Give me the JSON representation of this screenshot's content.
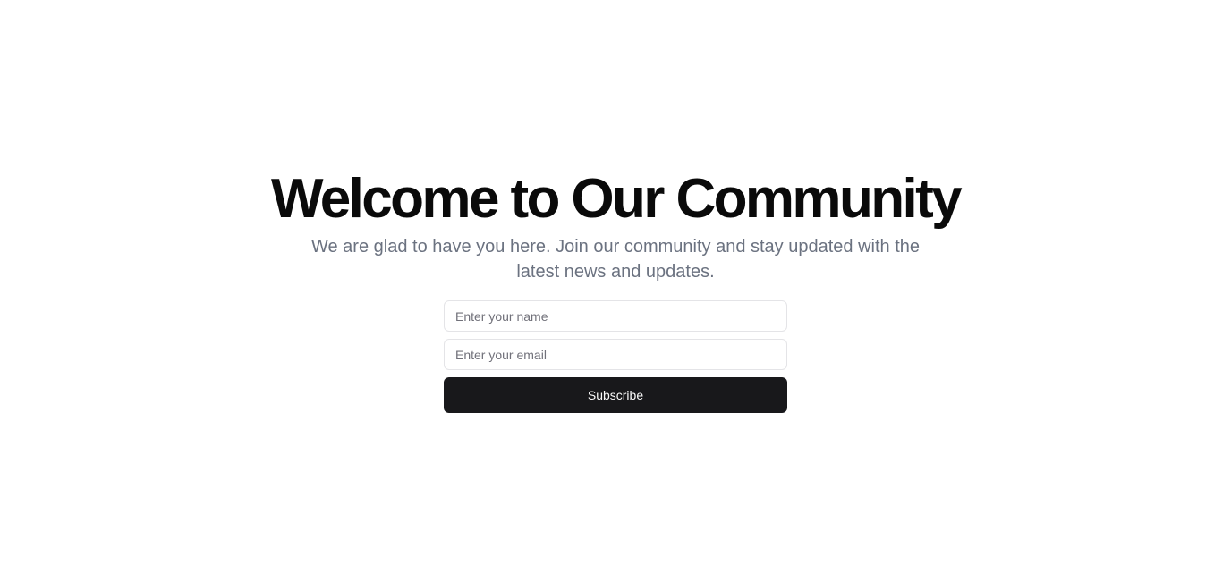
{
  "hero": {
    "title": "Welcome to Our Community",
    "subtitle": "We are glad to have you here. Join our community and stay updated with the latest news and updates."
  },
  "form": {
    "name_input": {
      "value": "",
      "placeholder": "Enter your name"
    },
    "email_input": {
      "value": "",
      "placeholder": "Enter your email"
    },
    "subscribe_label": "Subscribe"
  },
  "colors": {
    "background": "#ffffff",
    "title": "#0a0a0a",
    "subtitle": "#6b7280",
    "input_border": "#e4e4e7",
    "button_background": "#18181b",
    "button_text": "#fafafa"
  }
}
